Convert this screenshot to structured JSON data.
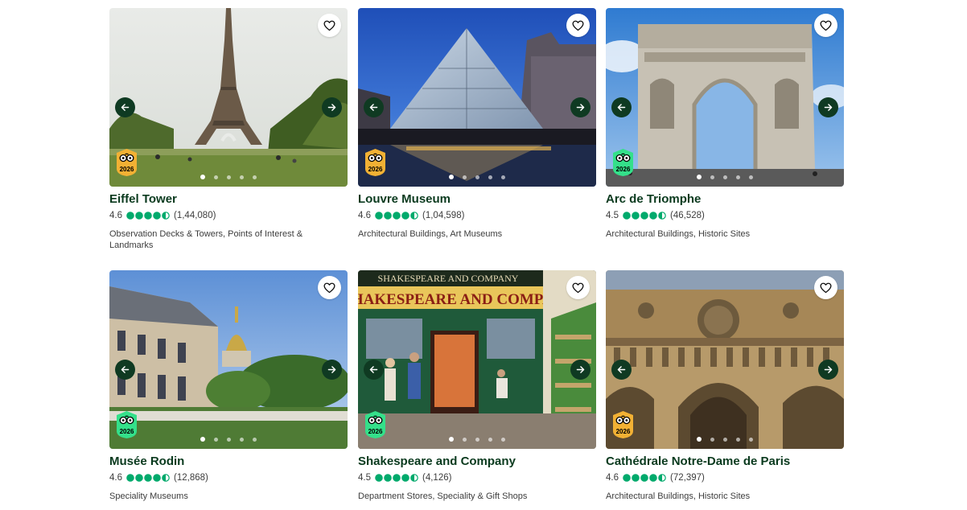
{
  "colors": {
    "title": "#0a3a1e",
    "nav_button": "#0f3a22",
    "rating_bubble": "#00aa6c",
    "badge_gold": "#f2b134",
    "badge_green": "#34e08a"
  },
  "icons": {
    "favorite": "heart-outline-icon",
    "prev": "arrow-left-icon",
    "next": "arrow-right-icon",
    "award": "travelers-choice-award-icon"
  },
  "cards": [
    {
      "name": "Eiffel Tower",
      "rating": "4.6",
      "rating_value": 4.5,
      "reviews": "(1,44,080)",
      "categories": "Observation Decks & Towers, Points of Interest & Landmarks",
      "award_year": "2026",
      "award_color": "gold",
      "photo_count": 5,
      "active_photo": 1
    },
    {
      "name": "Louvre Museum",
      "rating": "4.6",
      "rating_value": 4.5,
      "reviews": "(1,04,598)",
      "categories": "Architectural Buildings, Art Museums",
      "award_year": "2026",
      "award_color": "gold",
      "photo_count": 5,
      "active_photo": 1
    },
    {
      "name": "Arc de Triomphe",
      "rating": "4.5",
      "rating_value": 4.5,
      "reviews": "(46,528)",
      "categories": "Architectural Buildings, Historic Sites",
      "award_year": "2026",
      "award_color": "green",
      "photo_count": 5,
      "active_photo": 1
    },
    {
      "name": "Musée Rodin",
      "rating": "4.6",
      "rating_value": 4.5,
      "reviews": "(12,868)",
      "categories": "Speciality Museums",
      "award_year": "2026",
      "award_color": "green",
      "photo_count": 5,
      "active_photo": 1
    },
    {
      "name": "Shakespeare and Company",
      "rating": "4.5",
      "rating_value": 4.5,
      "reviews": "(4,126)",
      "categories": "Department Stores, Speciality & Gift Shops",
      "award_year": "2026",
      "award_color": "green",
      "photo_count": 5,
      "active_photo": 1,
      "shop_sign_top": "SHAKESPEARE AND COMPANY",
      "shop_sign_main": "SHAKESPEARE AND COMPA"
    },
    {
      "name": "Cathédrale Notre-Dame de Paris",
      "rating": "4.6",
      "rating_value": 4.5,
      "reviews": "(72,397)",
      "categories": "Architectural Buildings, Historic Sites",
      "award_year": "2026",
      "award_color": "gold",
      "photo_count": 5,
      "active_photo": 1
    }
  ]
}
